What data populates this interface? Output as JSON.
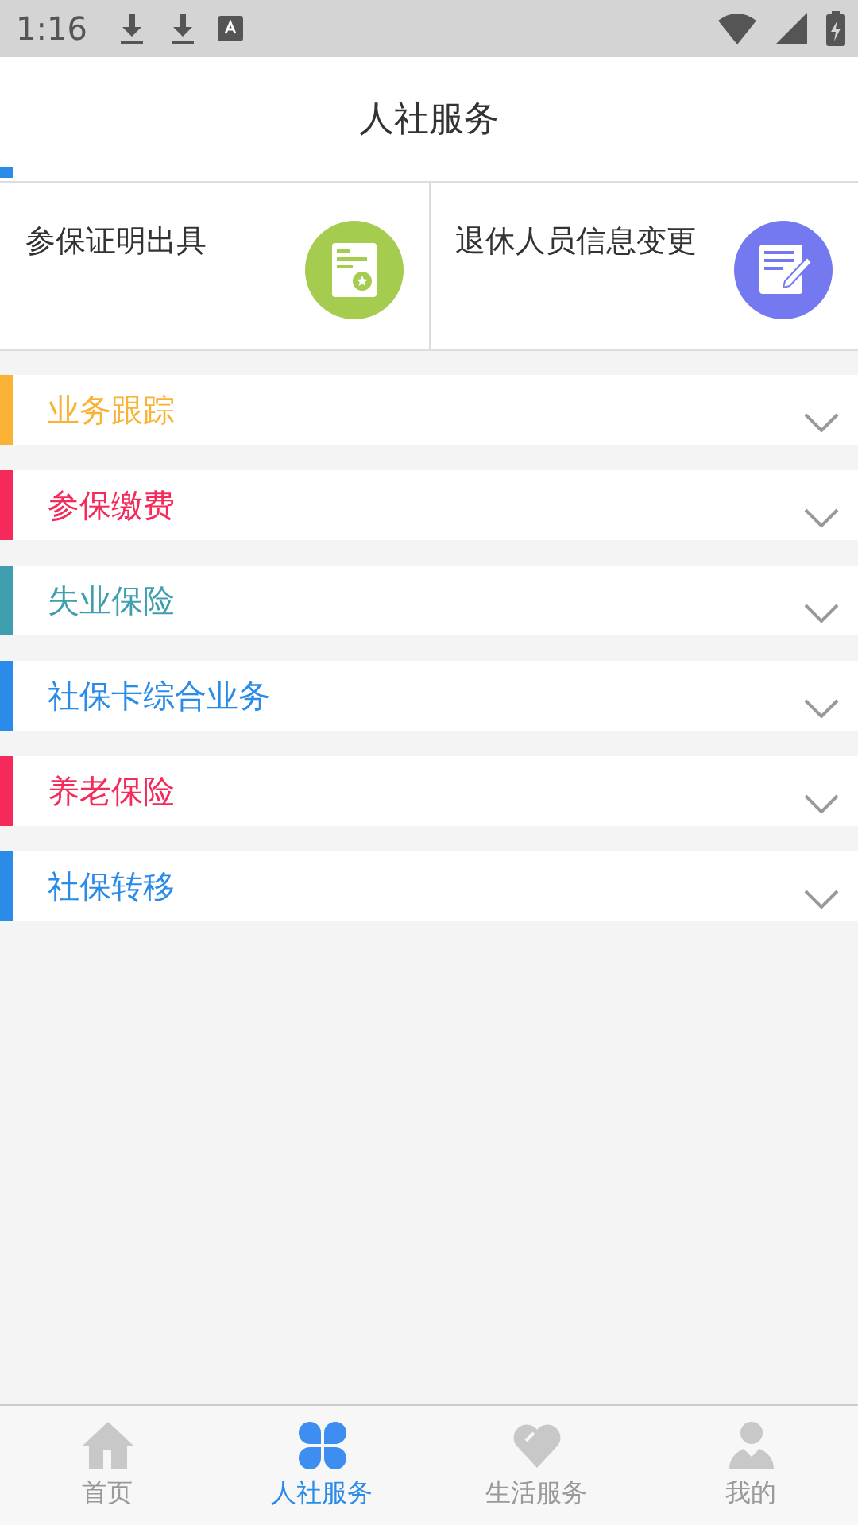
{
  "status_bar": {
    "time": "1:16"
  },
  "header": {
    "title": "人社服务"
  },
  "quick_actions": [
    {
      "label": "参保证明出具",
      "kind": "certificate",
      "color": "#a5cb4f"
    },
    {
      "label": "退休人员信息变更",
      "kind": "edit",
      "color": "#7479ef"
    }
  ],
  "sections": [
    {
      "label": "业务跟踪",
      "color": "#f9b233",
      "expanded": false
    },
    {
      "label": "参保缴费",
      "color": "#f5295a",
      "expanded": false
    },
    {
      "label": "失业保险",
      "color": "#3f9fae",
      "expanded": false
    },
    {
      "label": "社保卡综合业务",
      "color": "#2a8ce8",
      "expanded": false
    },
    {
      "label": "养老保险",
      "color": "#f5295a",
      "expanded": false
    },
    {
      "label": "社保转移",
      "color": "#2a8ce8",
      "expanded": false
    }
  ],
  "tab_bar": [
    {
      "label": "首页",
      "kind": "home",
      "selected": false
    },
    {
      "label": "人社服务",
      "kind": "clover",
      "selected": true
    },
    {
      "label": "生活服务",
      "kind": "heart",
      "selected": false
    },
    {
      "label": "我的",
      "kind": "person",
      "selected": false
    }
  ]
}
